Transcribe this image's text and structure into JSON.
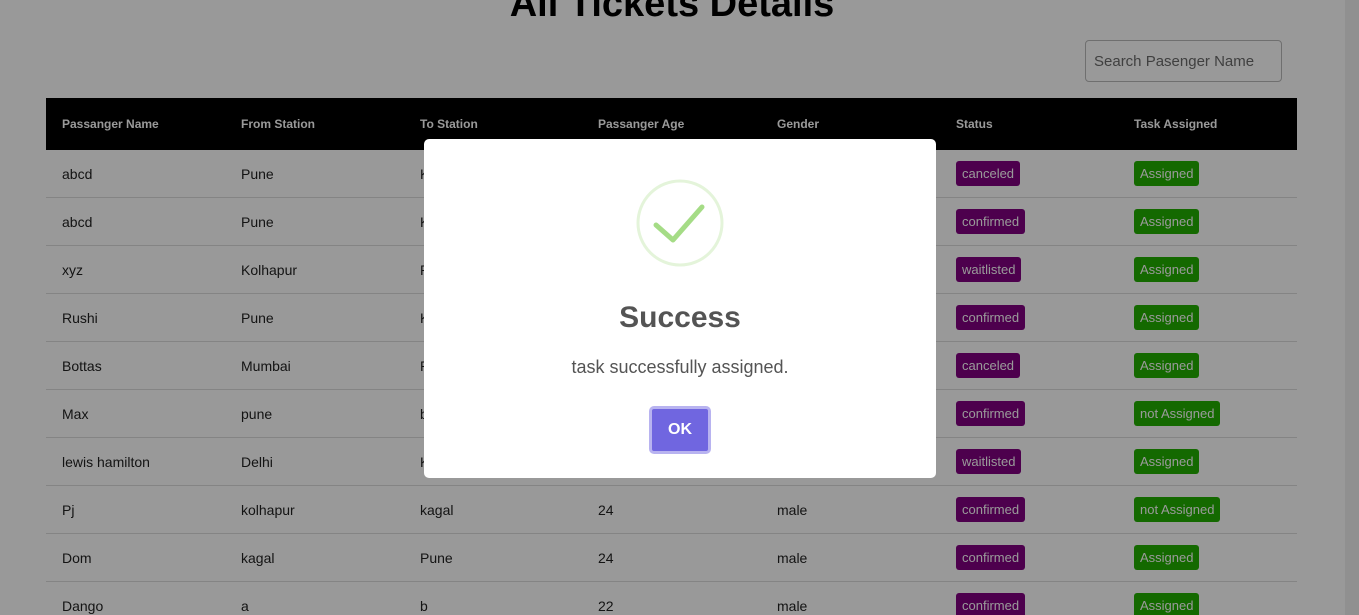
{
  "page": {
    "title": "All Tickets Details"
  },
  "search": {
    "placeholder": "Search Pasenger Name"
  },
  "table": {
    "headers": [
      "Passanger Name",
      "From Station",
      "To Station",
      "Passanger Age",
      "Gender",
      "Status",
      "Task Assigned"
    ],
    "rows": [
      {
        "name": "abcd",
        "from": "Pune",
        "to": "K",
        "age": "",
        "gender": "",
        "status": "canceled",
        "task": "Assigned"
      },
      {
        "name": "abcd",
        "from": "Pune",
        "to": "K",
        "age": "",
        "gender": "",
        "status": "confirmed",
        "task": "Assigned"
      },
      {
        "name": "xyz",
        "from": "Kolhapur",
        "to": "P",
        "age": "",
        "gender": "",
        "status": "waitlisted",
        "task": "Assigned"
      },
      {
        "name": "Rushi",
        "from": "Pune",
        "to": "K",
        "age": "",
        "gender": "",
        "status": "confirmed",
        "task": "Assigned"
      },
      {
        "name": "Bottas",
        "from": "Mumbai",
        "to": "P",
        "age": "",
        "gender": "",
        "status": "canceled",
        "task": "Assigned"
      },
      {
        "name": "Max",
        "from": "pune",
        "to": "b",
        "age": "",
        "gender": "",
        "status": "confirmed",
        "task": "not Assigned"
      },
      {
        "name": "lewis hamilton",
        "from": "Delhi",
        "to": "K",
        "age": "",
        "gender": "",
        "status": "waitlisted",
        "task": "Assigned"
      },
      {
        "name": "Pj",
        "from": "kolhapur",
        "to": "kagal",
        "age": "24",
        "gender": "male",
        "status": "confirmed",
        "task": "not Assigned"
      },
      {
        "name": "Dom",
        "from": "kagal",
        "to": "Pune",
        "age": "24",
        "gender": "male",
        "status": "confirmed",
        "task": "Assigned"
      },
      {
        "name": "Dango",
        "from": "a",
        "to": "b",
        "age": "22",
        "gender": "male",
        "status": "confirmed",
        "task": "Assigned"
      }
    ]
  },
  "modal": {
    "icon": "success-check-icon",
    "title": "Success",
    "message": "task successfully assigned.",
    "ok_label": "OK"
  },
  "colors": {
    "status_badge": "#800080",
    "task_badge": "#22b000",
    "ok_button": "#7066e0",
    "success_icon": "#a5dc86"
  }
}
